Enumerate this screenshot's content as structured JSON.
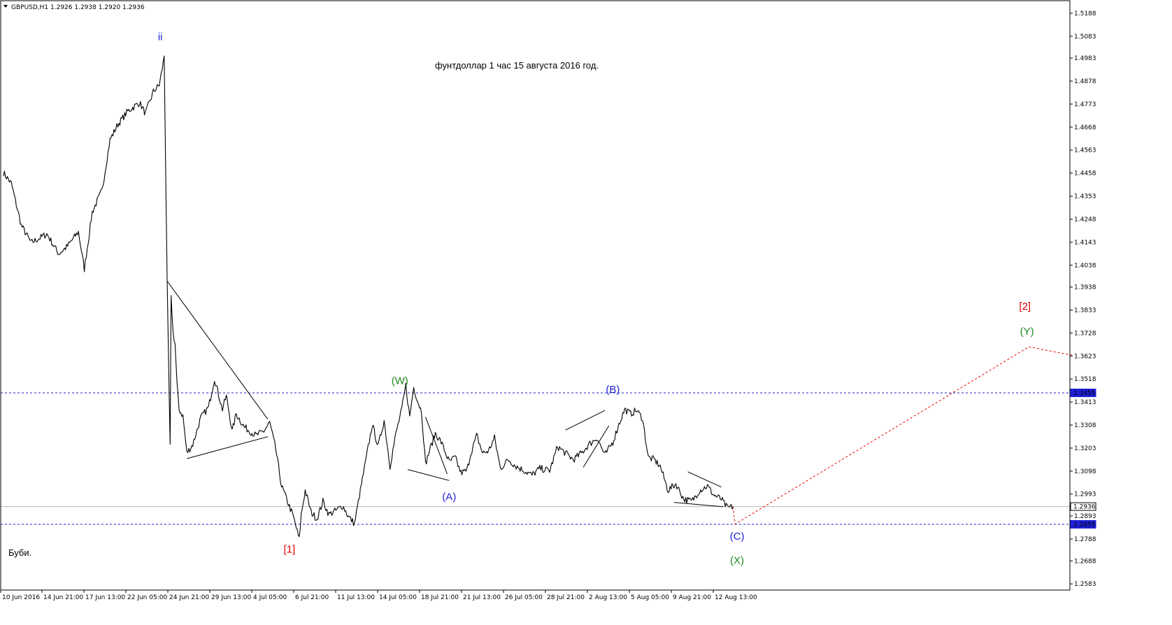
{
  "header": {
    "symbol": "GBPUSD,H1",
    "ohlc": "1.2926 1.2938 1.2920 1.2936"
  },
  "annotation_title": "фунтдоллар 1 час 15 августа 2016 год.",
  "signature": "Буби.",
  "colors": {
    "blue": "#1f1fd6",
    "green": "#1f8a1f",
    "red": "#e00000",
    "candle": "#000000",
    "grid_dash": "#1f1fd6",
    "projection": "#e00000"
  },
  "chart_data": {
    "type": "line",
    "symbol": "GBPUSD",
    "timeframe": "H1",
    "x_labels": [
      "10 Jun 2016",
      "14 Jun 21:00",
      "17 Jun 13:00",
      "22 Jun 05:00",
      "24 Jun 21:00",
      "29 Jun 13:00",
      "4 Jul 05:00",
      "6 Jul 21:00",
      "11 Jul 13:00",
      "14 Jul 05:00",
      "18 Jul 21:00",
      "21 Jul 13:00",
      "26 Jul 05:00",
      "28 Jul 21:00",
      "2 Aug 13:00",
      "5 Aug 05:00",
      "9 Aug 21:00",
      "12 Aug 13:00"
    ],
    "y_ticks": [
      "1.5188",
      "1.5083",
      "1.4983",
      "1.4878",
      "1.4773",
      "1.4668",
      "1.4563",
      "1.4458",
      "1.4353",
      "1.4248",
      "1.4143",
      "1.4038",
      "1.3938",
      "1.3833",
      "1.3728",
      "1.3623",
      "1.3518",
      "1.3413",
      "1.3308",
      "1.3203",
      "1.3098",
      "1.2993",
      "1.2893",
      "1.2788",
      "1.2688",
      "1.2583"
    ],
    "ylim": [
      1.2555,
      1.5245
    ],
    "price_markers": [
      {
        "label": "1.3455",
        "value": 1.3455,
        "style": "dashed"
      },
      {
        "label": "1.2855",
        "value": 1.2855,
        "style": "dashed"
      },
      {
        "label": "1.2936",
        "value": 1.2936,
        "style": "solid"
      }
    ],
    "price_path": [
      [
        0,
        1.446
      ],
      [
        4,
        1.441
      ],
      [
        9,
        1.422
      ],
      [
        14,
        1.414
      ],
      [
        22,
        1.418
      ],
      [
        28,
        1.409
      ],
      [
        32,
        1.412
      ],
      [
        38,
        1.419
      ],
      [
        41,
        1.402
      ],
      [
        45,
        1.428
      ],
      [
        50,
        1.438
      ],
      [
        54,
        1.461
      ],
      [
        58,
        1.468
      ],
      [
        63,
        1.474
      ],
      [
        69,
        1.478
      ],
      [
        72,
        1.473
      ],
      [
        76,
        1.483
      ],
      [
        79,
        1.486
      ],
      [
        81,
        1.496
      ],
      [
        81.5,
        1.4995
      ],
      [
        82.5,
        1.43
      ],
      [
        83,
        1.396
      ],
      [
        84,
        1.345
      ],
      [
        84.5,
        1.322
      ],
      [
        85,
        1.39
      ],
      [
        86,
        1.373
      ],
      [
        87,
        1.368
      ],
      [
        88,
        1.349
      ],
      [
        89,
        1.338
      ],
      [
        91,
        1.335
      ],
      [
        93,
        1.318
      ],
      [
        96,
        1.322
      ],
      [
        100,
        1.334
      ],
      [
        104,
        1.339
      ],
      [
        107,
        1.352
      ],
      [
        109,
        1.345
      ],
      [
        111,
        1.338
      ],
      [
        113,
        1.344
      ],
      [
        116,
        1.328
      ],
      [
        118,
        1.336
      ],
      [
        122,
        1.33
      ],
      [
        128,
        1.326
      ],
      [
        132,
        1.328
      ],
      [
        135,
        1.332
      ],
      [
        138,
        1.32
      ],
      [
        141,
        1.303
      ],
      [
        144,
        1.296
      ],
      [
        147,
        1.289
      ],
      [
        149,
        1.282
      ],
      [
        150,
        1.2787
      ],
      [
        151,
        1.29
      ],
      [
        153,
        1.301
      ],
      [
        156,
        1.291
      ],
      [
        159,
        1.288
      ],
      [
        162,
        1.296
      ],
      [
        165,
        1.29
      ],
      [
        169,
        1.292
      ],
      [
        172,
        1.294
      ],
      [
        175,
        1.289
      ],
      [
        178,
        1.2858
      ],
      [
        181,
        1.301
      ],
      [
        184,
        1.316
      ],
      [
        187,
        1.331
      ],
      [
        190,
        1.321
      ],
      [
        193,
        1.333
      ],
      [
        196,
        1.312
      ],
      [
        199,
        1.327
      ],
      [
        202,
        1.338
      ],
      [
        204,
        1.349
      ],
      [
        206,
        1.3345
      ],
      [
        208,
        1.348
      ],
      [
        210,
        1.342
      ],
      [
        212,
        1.337
      ],
      [
        214,
        1.313
      ],
      [
        216,
        1.319
      ],
      [
        219,
        1.327
      ],
      [
        222,
        1.323
      ],
      [
        226,
        1.314
      ],
      [
        229,
        1.316
      ],
      [
        232,
        1.309
      ],
      [
        235,
        1.31
      ],
      [
        237,
        1.318
      ],
      [
        240,
        1.326
      ],
      [
        243,
        1.318
      ],
      [
        246,
        1.319
      ],
      [
        249,
        1.325
      ],
      [
        252,
        1.311
      ],
      [
        256,
        1.315
      ],
      [
        260,
        1.312
      ],
      [
        264,
        1.31
      ],
      [
        268,
        1.308
      ],
      [
        272,
        1.311
      ],
      [
        277,
        1.31
      ],
      [
        281,
        1.321
      ],
      [
        285,
        1.318
      ],
      [
        289,
        1.315
      ],
      [
        293,
        1.318
      ],
      [
        297,
        1.322
      ],
      [
        301,
        1.325
      ],
      [
        305,
        1.317
      ],
      [
        309,
        1.323
      ],
      [
        312,
        1.331
      ],
      [
        315,
        1.338
      ],
      [
        318,
        1.336
      ],
      [
        321,
        1.3375
      ],
      [
        324,
        1.334
      ],
      [
        327,
        1.316
      ],
      [
        330,
        1.315
      ],
      [
        333,
        1.312
      ],
      [
        337,
        1.301
      ],
      [
        341,
        1.304
      ],
      [
        345,
        1.297
      ],
      [
        349,
        1.296
      ],
      [
        353,
        1.301
      ],
      [
        357,
        1.303
      ],
      [
        360,
        1.299
      ],
      [
        364,
        1.297
      ],
      [
        367,
        1.293
      ],
      [
        370,
        1.2936
      ]
    ],
    "projection_path": [
      [
        370,
        1.2936
      ],
      [
        371,
        1.2856
      ],
      [
        520,
        1.3665
      ],
      [
        543,
        1.3625
      ]
    ],
    "wave_labels": [
      {
        "text": "ii",
        "x": 79.5,
        "y": 1.5065,
        "color": "blue"
      },
      {
        "text": "[1]",
        "x": 145,
        "y": 1.2725,
        "color": "red"
      },
      {
        "text": "(W)",
        "x": 201,
        "y": 1.3495,
        "color": "green"
      },
      {
        "text": "(A)",
        "x": 226,
        "y": 1.2965,
        "color": "blue"
      },
      {
        "text": "(B)",
        "x": 309,
        "y": 1.3455,
        "color": "blue"
      },
      {
        "text": "(C)",
        "x": 372,
        "y": 1.2785,
        "color": "blue"
      },
      {
        "text": "(X)",
        "x": 372,
        "y": 1.2675,
        "color": "green"
      },
      {
        "text": "[2]",
        "x": 518,
        "y": 1.3835,
        "color": "red"
      },
      {
        "text": "(Y)",
        "x": 519,
        "y": 1.372,
        "color": "green"
      }
    ],
    "trendlines": [
      [
        [
          83,
          1.3965
        ],
        [
          134,
          1.3335
        ]
      ],
      [
        [
          93,
          1.3155
        ],
        [
          134,
          1.3255
        ]
      ],
      [
        [
          205,
          1.3105
        ],
        [
          226,
          1.3055
        ]
      ],
      [
        [
          214,
          1.3345
        ],
        [
          225,
          1.3085
        ]
      ],
      [
        [
          285,
          1.3285
        ],
        [
          305,
          1.3375
        ]
      ],
      [
        [
          294,
          1.3115
        ],
        [
          307,
          1.3305
        ]
      ],
      [
        [
          340,
          1.2955
        ],
        [
          365,
          1.2935
        ]
      ],
      [
        [
          347,
          1.3095
        ],
        [
          364,
          1.3025
        ]
      ]
    ]
  }
}
